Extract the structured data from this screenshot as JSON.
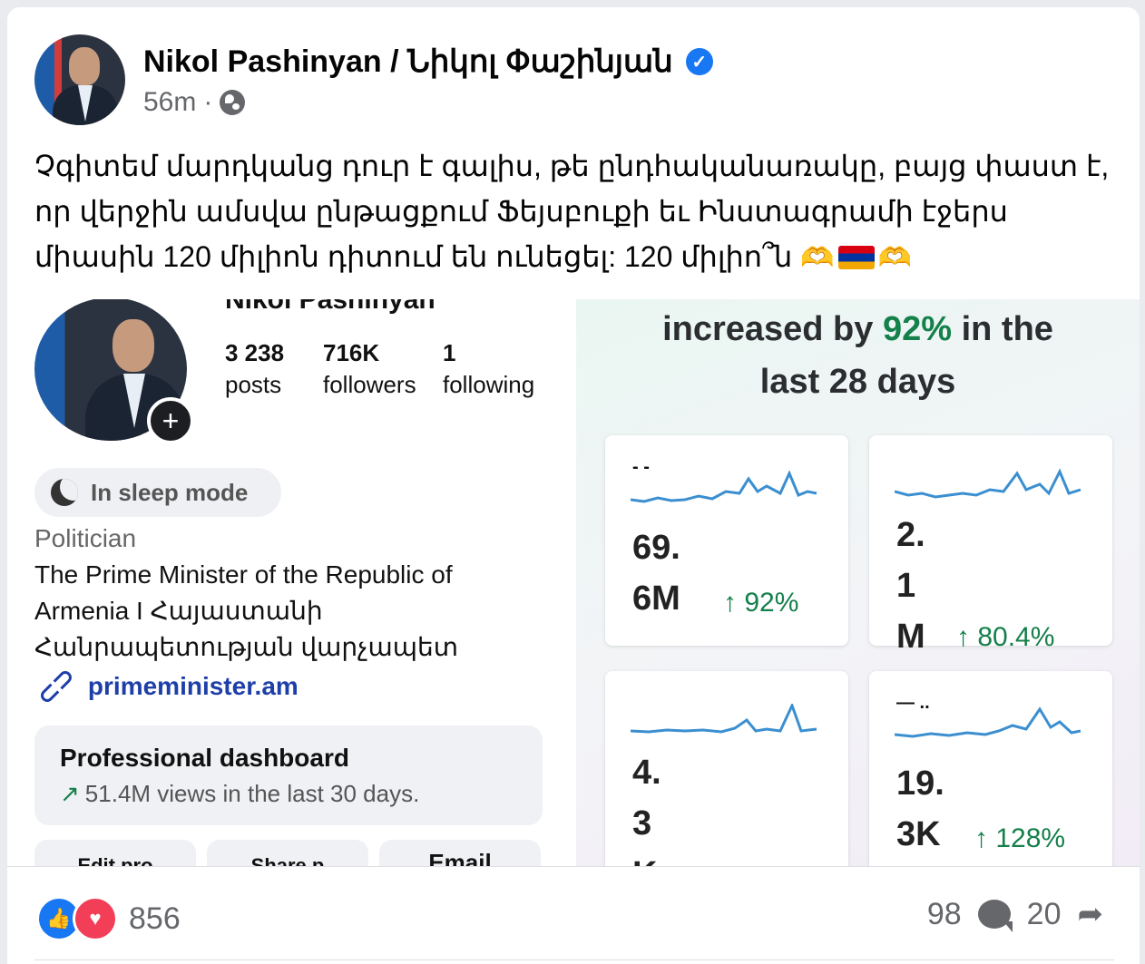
{
  "author": {
    "name": "Nikol Pashinyan / Նիկոլ Փաշինյան",
    "verified": true,
    "time": "56m",
    "separator": "·",
    "audience_icon": "globe-icon"
  },
  "post": {
    "text": "Չգիտեմ մարդկանց դուր է գալիս, թե ընդհականառակը, բայց փաստ է, որ վերջին ամսվա ընթացքում Ֆեյսբուքի եւ Ինստագրամի էջերս միասին 120 միլիոն դիտում են ունեցել: 120 միլիո՞ն"
  },
  "instagram": {
    "name_cut": "Nikol Pashinyan",
    "stats": [
      {
        "value": "3 238",
        "label": "posts"
      },
      {
        "value": "716K",
        "label": "followers"
      },
      {
        "value": "1",
        "label": "following"
      }
    ],
    "sleep_mode": "In sleep mode",
    "category": "Politician",
    "bio_line1": "The Prime Minister of the Republic of",
    "bio_line2": "Armenia I Հայաստանի",
    "bio_line3": "Հանրապետության վարչապետ",
    "link": "primeminister.am",
    "dashboard_title": "Professional dashboard",
    "dashboard_sub": "51.4M views in the last 30 days.",
    "buttons": [
      "Edit pro",
      "Share p",
      "Email"
    ]
  },
  "insights": {
    "headline_pre": "increased by ",
    "headline_pct": "92%",
    "headline_post": " in the",
    "headline_line2": "last 28 days",
    "cards": [
      {
        "label": "- -",
        "value_l1": "69.",
        "value_l2": "6M",
        "value_l3": "",
        "change": "↑ 92%"
      },
      {
        "label": "",
        "value_l1": "2.",
        "value_l2": "1",
        "value_l3": "M",
        "change": "↑ 80.4%"
      },
      {
        "label": "",
        "value_l1": "4.",
        "value_l2": "3",
        "value_l3": "K",
        "change": ""
      },
      {
        "label": "— ..",
        "value_l1": "19.",
        "value_l2": "3K",
        "value_l3": "",
        "change": "↑ 128%"
      }
    ],
    "accent_color": "#14804a"
  },
  "footer": {
    "reaction_count": "856",
    "comment_count": "98",
    "share_count": "20"
  }
}
